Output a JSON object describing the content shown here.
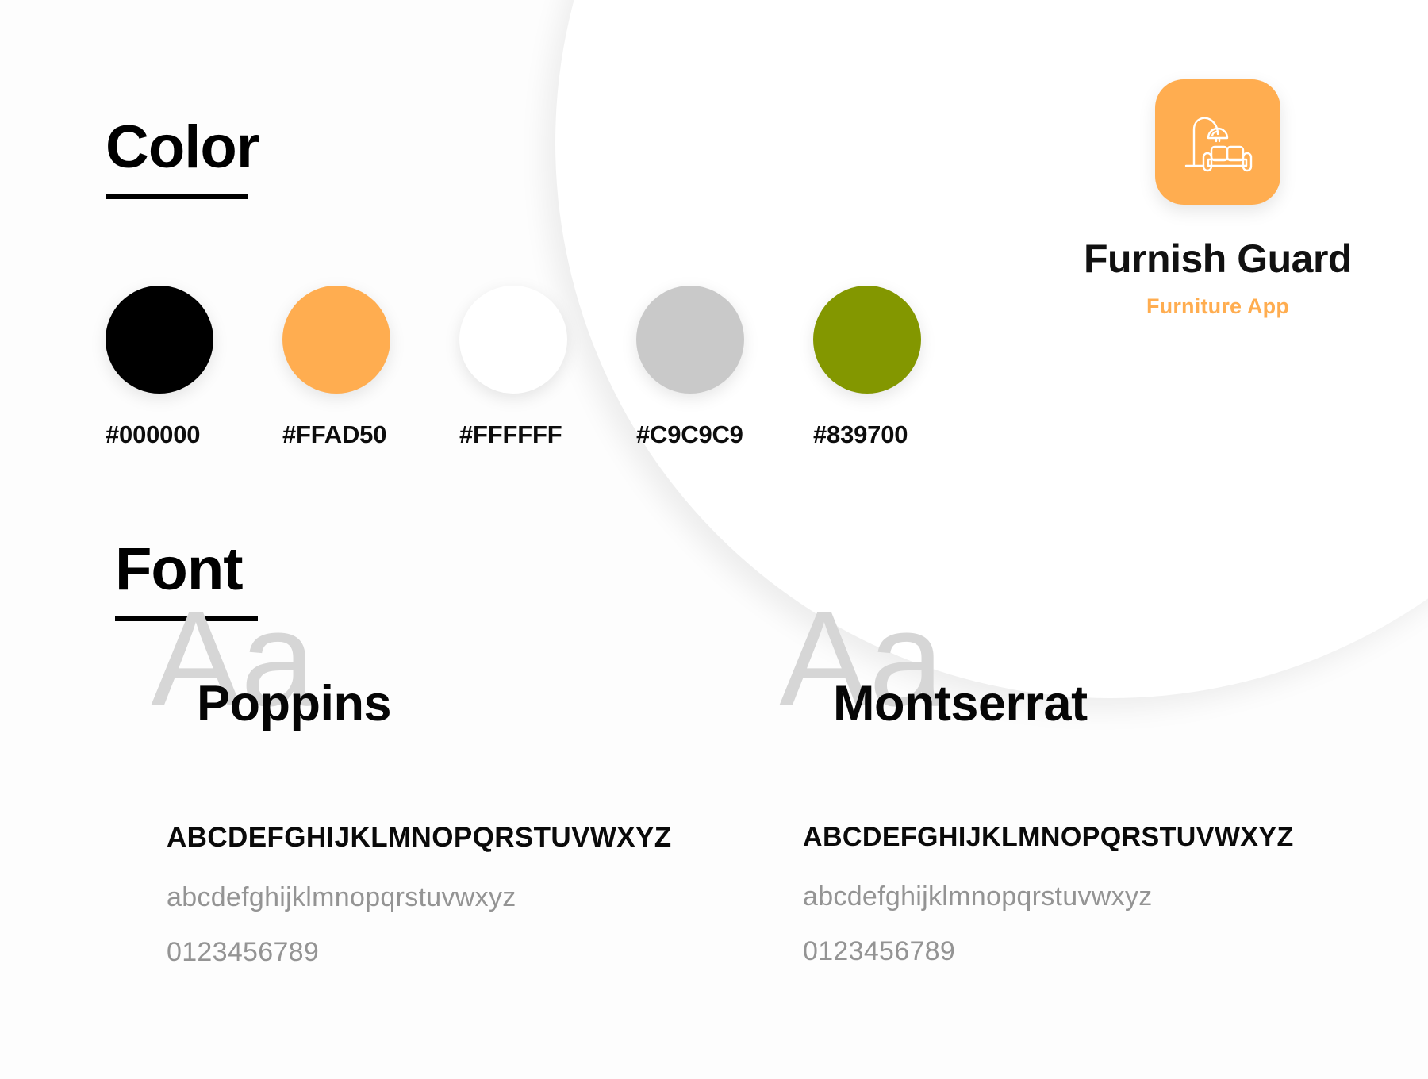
{
  "brand": {
    "logo_icon": "floor-lamp-and-sofa-icon",
    "logo_background": "#FFAD50",
    "name": "Furnish Guard",
    "tagline": "Furniture App",
    "tagline_color": "#FFAD50"
  },
  "color_section": {
    "title": "Color",
    "swatches": [
      {
        "hex": "#000000",
        "label": "#000000"
      },
      {
        "hex": "#FFAD50",
        "label": "#FFAD50"
      },
      {
        "hex": "#FFFFFF",
        "label": "#FFFFFF"
      },
      {
        "hex": "#C9C9C9",
        "label": "#C9C9C9"
      },
      {
        "hex": "#839700",
        "label": "#839700"
      }
    ]
  },
  "font_section": {
    "title": "Font",
    "fonts": [
      {
        "watermark": "Aa",
        "name": "Poppins",
        "uppercase": "ABCDEFGHIJKLMNOPQRSTUVWXYZ",
        "lowercase": "abcdefghijklmnopqrstuvwxyz",
        "digits": "0123456789"
      },
      {
        "watermark": "Aa",
        "name": "Montserrat",
        "uppercase": "ABCDEFGHIJKLMNOPQRSTUVWXYZ",
        "lowercase": "abcdefghijklmnopqrstuvwxyz",
        "digits": "0123456789"
      }
    ]
  }
}
